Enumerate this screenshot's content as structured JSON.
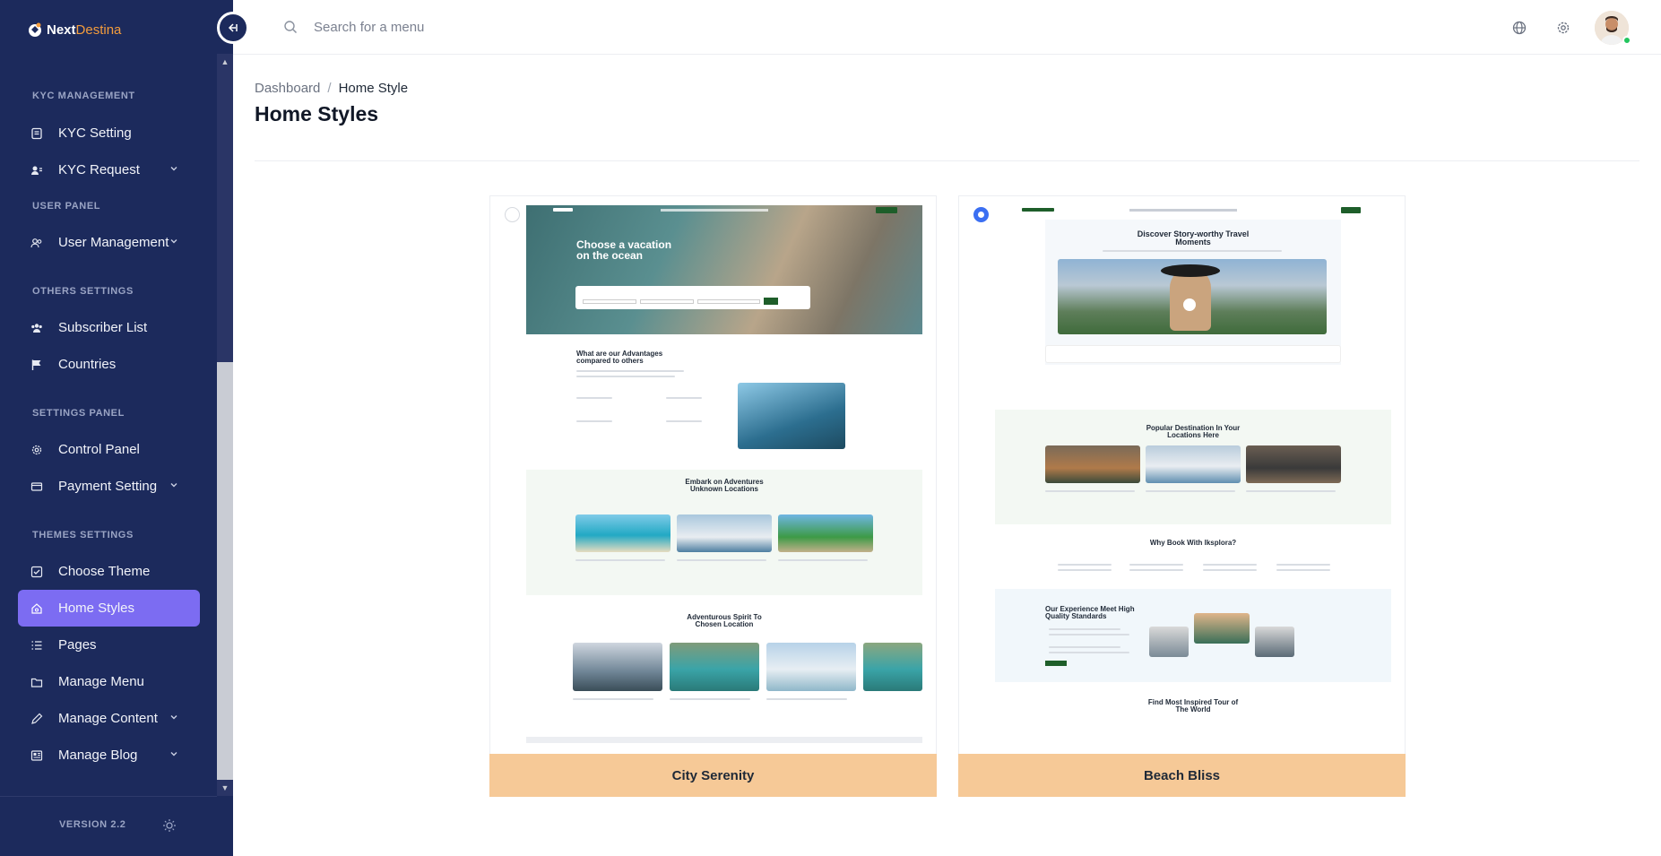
{
  "brand": {
    "name_part1": "Next",
    "name_part2": "Destina"
  },
  "search": {
    "placeholder": "Search for a menu"
  },
  "sidebar": {
    "sections": [
      {
        "title": "KYC MANAGEMENT",
        "items": [
          {
            "label": "KYC Setting",
            "icon": "document-icon",
            "has_children": false
          },
          {
            "label": "KYC Request",
            "icon": "user-card-icon",
            "has_children": true
          }
        ]
      },
      {
        "title": "USER PANEL",
        "items": [
          {
            "label": "User Management",
            "icon": "users-icon",
            "has_children": true
          }
        ]
      },
      {
        "title": "OTHERS SETTINGS",
        "items": [
          {
            "label": "Subscriber List",
            "icon": "group-icon",
            "has_children": false
          },
          {
            "label": "Countries",
            "icon": "flag-icon",
            "has_children": false
          }
        ]
      },
      {
        "title": "SETTINGS PANEL",
        "items": [
          {
            "label": "Control Panel",
            "icon": "gear-icon",
            "has_children": false
          },
          {
            "label": "Payment Setting",
            "icon": "card-icon",
            "has_children": true
          }
        ]
      },
      {
        "title": "THEMES SETTINGS",
        "items": [
          {
            "label": "Choose Theme",
            "icon": "check-square-icon",
            "has_children": false
          },
          {
            "label": "Home Styles",
            "icon": "home-icon",
            "has_children": false,
            "active": true
          },
          {
            "label": "Pages",
            "icon": "list-icon",
            "has_children": false
          },
          {
            "label": "Manage Menu",
            "icon": "folder-icon",
            "has_children": false
          },
          {
            "label": "Manage Content",
            "icon": "pencil-icon",
            "has_children": true
          },
          {
            "label": "Manage Blog",
            "icon": "newspaper-icon",
            "has_children": true
          }
        ]
      }
    ],
    "version": "VERSION 2.2"
  },
  "breadcrumb": {
    "root": "Dashboard",
    "separator": "/",
    "current": "Home Style"
  },
  "page": {
    "title": "Home Styles"
  },
  "cards": [
    {
      "label": "City Serenity",
      "selected": false,
      "preview": {
        "hero_title_1": "Choose a vacation",
        "hero_title_2": "on the ocean",
        "sec1_1": "What are our Advantages",
        "sec1_2": "compared to others",
        "sec2_1": "Embark on Adventures",
        "sec2_2": "Unknown Locations",
        "sec3_1": "Adventurous Spirit To",
        "sec3_2": "Chosen Location"
      }
    },
    {
      "label": "Beach Bliss",
      "selected": true,
      "preview": {
        "hero_title_1": "Discover Story-worthy Travel",
        "hero_title_2": "Moments",
        "sec1_1": "Popular Destination In Your",
        "sec1_2": "Locations Here",
        "sec2_1": "Why Book With Iksplora?",
        "sec3_1": "Our Experience Meet High",
        "sec3_2": "Quality Standards",
        "sec4_1": "Find Most Inspired Tour of",
        "sec4_2": "The World"
      }
    }
  ],
  "colors": {
    "sidebar_bg": "#1c2a5c",
    "active_item": "#7c6cf2",
    "brand_accent": "#f39c3c",
    "card_label_bg": "#f6c997",
    "radio_selected": "#3b6ff2"
  }
}
